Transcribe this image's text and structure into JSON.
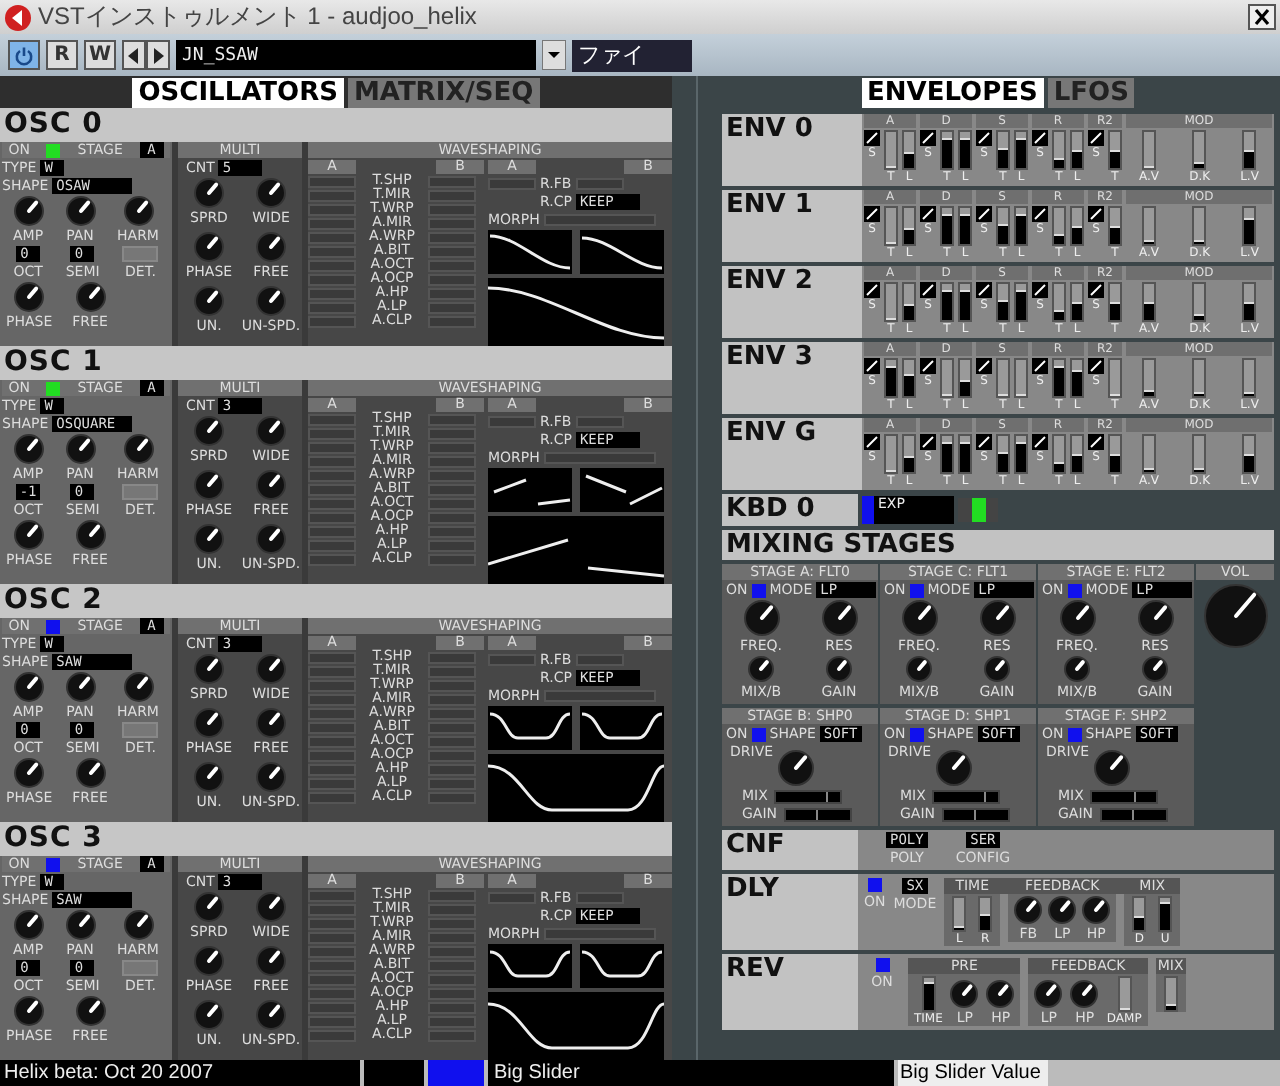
{
  "window": {
    "title": "VSTインストゥルメント 1 - audjoo_helix"
  },
  "toolbar": {
    "power_on": true,
    "read_button": "R",
    "write_button": "W",
    "preset": "JN_SSAW",
    "file_field": "ファイ"
  },
  "left_tabs": [
    {
      "label": "OSCILLATORS",
      "selected": true
    },
    {
      "label": "MATRIX/SEQ",
      "selected": false
    }
  ],
  "oscillators": [
    {
      "title": "OSC 0",
      "on_label": "ON",
      "led": {
        "color": "#22dd22"
      },
      "stage_label": "STAGE",
      "stage": "A",
      "type_label": "TYPE",
      "type": "W",
      "shape_label": "SHAPE",
      "shape": "OSAW",
      "knobs_top": [
        "AMP",
        "PAN",
        "HARM"
      ],
      "oct_label": "OCT",
      "oct": "0",
      "semi_label": "SEMI",
      "semi": "0",
      "det_label": "DET.",
      "knobs_bottom": [
        "PHASE",
        "FREE"
      ],
      "multi": {
        "title": "MULTI",
        "cnt_label": "CNT",
        "cnt": "5",
        "knobs": [
          "SPRD",
          "WIDE",
          "PHASE",
          "FREE",
          "UN.",
          "UN-SPD."
        ]
      },
      "waveshaping": {
        "title": "WAVESHAPING",
        "col_a": "A",
        "col_b": "B",
        "params": [
          "T.SHP",
          "T.MIR",
          "T.WRP",
          "A.MIR",
          "A.WRP",
          "A.BIT",
          "A.OCT",
          "A.OCP",
          "A.HP",
          "A.LP",
          "A.CLP"
        ],
        "morph_a": "A",
        "morph_b": "B",
        "rfb_label": "R.FB",
        "rcp_label": "R.CP",
        "rcp": "KEEP",
        "morph_label": "MORPH"
      }
    },
    {
      "title": "OSC 1",
      "on_label": "ON",
      "led": {
        "color": "#22dd22"
      },
      "stage_label": "STAGE",
      "stage": "A",
      "type_label": "TYPE",
      "type": "W",
      "shape_label": "SHAPE",
      "shape": "OSQUARE",
      "knobs_top": [
        "AMP",
        "PAN",
        "HARM"
      ],
      "oct_label": "OCT",
      "oct": "-1",
      "semi_label": "SEMI",
      "semi": "0",
      "det_label": "DET.",
      "knobs_bottom": [
        "PHASE",
        "FREE"
      ],
      "multi": {
        "title": "MULTI",
        "cnt_label": "CNT",
        "cnt": "3",
        "knobs": [
          "SPRD",
          "WIDE",
          "PHASE",
          "FREE",
          "UN.",
          "UN-SPD."
        ]
      },
      "waveshaping": {
        "title": "WAVESHAPING",
        "col_a": "A",
        "col_b": "B",
        "params": [
          "T.SHP",
          "T.MIR",
          "T.WRP",
          "A.MIR",
          "A.WRP",
          "A.BIT",
          "A.OCT",
          "A.OCP",
          "A.HP",
          "A.LP",
          "A.CLP"
        ],
        "morph_a": "A",
        "morph_b": "B",
        "rfb_label": "R.FB",
        "rcp_label": "R.CP",
        "rcp": "KEEP",
        "morph_label": "MORPH"
      }
    },
    {
      "title": "OSC 2",
      "on_label": "ON",
      "led": {
        "color": "#1010ee"
      },
      "stage_label": "STAGE",
      "stage": "A",
      "type_label": "TYPE",
      "type": "W",
      "shape_label": "SHAPE",
      "shape": "SAW",
      "knobs_top": [
        "AMP",
        "PAN",
        "HARM"
      ],
      "oct_label": "OCT",
      "oct": "0",
      "semi_label": "SEMI",
      "semi": "0",
      "det_label": "DET.",
      "knobs_bottom": [
        "PHASE",
        "FREE"
      ],
      "multi": {
        "title": "MULTI",
        "cnt_label": "CNT",
        "cnt": "3",
        "knobs": [
          "SPRD",
          "WIDE",
          "PHASE",
          "FREE",
          "UN.",
          "UN-SPD."
        ]
      },
      "waveshaping": {
        "title": "WAVESHAPING",
        "col_a": "A",
        "col_b": "B",
        "params": [
          "T.SHP",
          "T.MIR",
          "T.WRP",
          "A.MIR",
          "A.WRP",
          "A.BIT",
          "A.OCT",
          "A.OCP",
          "A.HP",
          "A.LP",
          "A.CLP"
        ],
        "morph_a": "A",
        "morph_b": "B",
        "rfb_label": "R.FB",
        "rcp_label": "R.CP",
        "rcp": "KEEP",
        "morph_label": "MORPH"
      }
    },
    {
      "title": "OSC 3",
      "on_label": "ON",
      "led": {
        "color": "#1010ee"
      },
      "stage_label": "STAGE",
      "stage": "A",
      "type_label": "TYPE",
      "type": "W",
      "shape_label": "SHAPE",
      "shape": "SAW",
      "knobs_top": [
        "AMP",
        "PAN",
        "HARM"
      ],
      "oct_label": "OCT",
      "oct": "0",
      "semi_label": "SEMI",
      "semi": "0",
      "det_label": "DET.",
      "knobs_bottom": [
        "PHASE",
        "FREE"
      ],
      "multi": {
        "title": "MULTI",
        "cnt_label": "CNT",
        "cnt": "3",
        "knobs": [
          "SPRD",
          "WIDE",
          "PHASE",
          "FREE",
          "UN.",
          "UN-SPD."
        ]
      },
      "waveshaping": {
        "title": "WAVESHAPING",
        "col_a": "A",
        "col_b": "B",
        "params": [
          "T.SHP",
          "T.MIR",
          "T.WRP",
          "A.MIR",
          "A.WRP",
          "A.BIT",
          "A.OCT",
          "A.OCP",
          "A.HP",
          "A.LP",
          "A.CLP"
        ],
        "morph_a": "A",
        "morph_b": "B",
        "rfb_label": "R.FB",
        "rcp_label": "R.CP",
        "rcp": "KEEP",
        "morph_label": "MORPH"
      }
    }
  ],
  "right_tabs": [
    {
      "label": "ENVELOPES",
      "selected": true
    },
    {
      "label": "LFOS",
      "selected": false
    }
  ],
  "envelopes": [
    {
      "title": "ENV 0",
      "groups": [
        {
          "label": "A",
          "curve_label": "S",
          "sliders": [
            {
              "label": "T",
              "level": 0
            },
            {
              "label": "L",
              "level": 0.45
            }
          ]
        },
        {
          "label": "D",
          "curve_label": "S",
          "sliders": [
            {
              "label": "T",
              "level": 0.85
            },
            {
              "label": "L",
              "level": 0.85
            }
          ]
        },
        {
          "label": "S",
          "curve_label": "S",
          "sliders": [
            {
              "label": "T",
              "level": 0.55
            },
            {
              "label": "L",
              "level": 0.85
            }
          ]
        },
        {
          "label": "R",
          "curve_label": "S",
          "sliders": [
            {
              "label": "T",
              "level": 0.3
            },
            {
              "label": "L",
              "level": 0.5
            }
          ]
        },
        {
          "label": "R2",
          "curve_label": "S",
          "sliders": [
            {
              "label": "T",
              "level": 0.5
            }
          ]
        }
      ],
      "mod": {
        "label": "MOD",
        "sliders": [
          {
            "label": "A.V",
            "level": 0
          },
          {
            "label": "D.K",
            "level": 0.15
          },
          {
            "label": "L.V",
            "level": 0.5
          }
        ]
      }
    },
    {
      "title": "ENV 1",
      "groups": [
        {
          "label": "A",
          "curve_label": "S",
          "sliders": [
            {
              "label": "T",
              "level": 0
            },
            {
              "label": "L",
              "level": 0.45
            }
          ]
        },
        {
          "label": "D",
          "curve_label": "S",
          "sliders": [
            {
              "label": "T",
              "level": 0.85
            },
            {
              "label": "L",
              "level": 0.85
            }
          ]
        },
        {
          "label": "S",
          "curve_label": "S",
          "sliders": [
            {
              "label": "T",
              "level": 0.55
            },
            {
              "label": "L",
              "level": 0.85
            }
          ]
        },
        {
          "label": "R",
          "curve_label": "S",
          "sliders": [
            {
              "label": "T",
              "level": 0.3
            },
            {
              "label": "L",
              "level": 0.5
            }
          ]
        },
        {
          "label": "R2",
          "curve_label": "S",
          "sliders": [
            {
              "label": "T",
              "level": 0.5
            }
          ]
        }
      ],
      "mod": {
        "label": "MOD",
        "sliders": [
          {
            "label": "A.V",
            "level": 0.1
          },
          {
            "label": "D.K",
            "level": 0.1
          },
          {
            "label": "L.V",
            "level": 0.7
          }
        ]
      }
    },
    {
      "title": "ENV 2",
      "groups": [
        {
          "label": "A",
          "curve_label": "S",
          "sliders": [
            {
              "label": "T",
              "level": 0
            },
            {
              "label": "L",
              "level": 0.45
            }
          ]
        },
        {
          "label": "D",
          "curve_label": "S",
          "sliders": [
            {
              "label": "T",
              "level": 0.85
            },
            {
              "label": "L",
              "level": 0.85
            }
          ]
        },
        {
          "label": "S",
          "curve_label": "S",
          "sliders": [
            {
              "label": "T",
              "level": 0.55
            },
            {
              "label": "L",
              "level": 0.85
            }
          ]
        },
        {
          "label": "R",
          "curve_label": "S",
          "sliders": [
            {
              "label": "T",
              "level": 0.3
            },
            {
              "label": "L",
              "level": 0.5
            }
          ]
        },
        {
          "label": "R2",
          "curve_label": "S",
          "sliders": [
            {
              "label": "T",
              "level": 0.5
            }
          ]
        }
      ],
      "mod": {
        "label": "MOD",
        "sliders": [
          {
            "label": "A.V",
            "level": 0.5
          },
          {
            "label": "D.K",
            "level": 0.15
          },
          {
            "label": "L.V",
            "level": 0.5
          }
        ]
      }
    },
    {
      "title": "ENV 3",
      "groups": [
        {
          "label": "A",
          "curve_label": "S",
          "sliders": [
            {
              "label": "T",
              "level": 0.85
            },
            {
              "label": "L",
              "level": 0.6
            }
          ]
        },
        {
          "label": "D",
          "curve_label": "S",
          "sliders": [
            {
              "label": "T",
              "level": 0
            },
            {
              "label": "L",
              "level": 0.45
            }
          ]
        },
        {
          "label": "S",
          "curve_label": "S",
          "sliders": [
            {
              "label": "T",
              "level": 0
            },
            {
              "label": "L",
              "level": 0
            }
          ]
        },
        {
          "label": "R",
          "curve_label": "S",
          "sliders": [
            {
              "label": "T",
              "level": 0.85
            },
            {
              "label": "L",
              "level": 0.7
            }
          ]
        },
        {
          "label": "R2",
          "curve_label": "S",
          "sliders": [
            {
              "label": "T",
              "level": 0
            }
          ]
        }
      ],
      "mod": {
        "label": "MOD",
        "sliders": [
          {
            "label": "A.V",
            "level": 0.15
          },
          {
            "label": "D.K",
            "level": 0.1
          },
          {
            "label": "L.V",
            "level": 0.1
          }
        ]
      }
    },
    {
      "title": "ENV G",
      "groups": [
        {
          "label": "A",
          "curve_label": "S",
          "sliders": [
            {
              "label": "T",
              "level": 0
            },
            {
              "label": "L",
              "level": 0.45
            }
          ]
        },
        {
          "label": "D",
          "curve_label": "S",
          "sliders": [
            {
              "label": "T",
              "level": 0.85
            },
            {
              "label": "L",
              "level": 0.85
            }
          ]
        },
        {
          "label": "S",
          "curve_label": "S",
          "sliders": [
            {
              "label": "T",
              "level": 0.55
            },
            {
              "label": "L",
              "level": 0.85
            }
          ]
        },
        {
          "label": "R",
          "curve_label": "S",
          "sliders": [
            {
              "label": "T",
              "level": 0.3
            },
            {
              "label": "L",
              "level": 0.5
            }
          ]
        },
        {
          "label": "R2",
          "curve_label": "S",
          "sliders": [
            {
              "label": "T",
              "level": 0.5
            }
          ]
        }
      ],
      "mod": {
        "label": "MOD",
        "sliders": [
          {
            "label": "A.V",
            "level": 0.1
          },
          {
            "label": "D.K",
            "level": 0.1
          },
          {
            "label": "L.V",
            "level": 0.5
          }
        ]
      }
    }
  ],
  "keyboard": {
    "title": "KBD 0",
    "mode": "EXP",
    "level": 0.5
  },
  "mixing": {
    "title": "MIXING STAGES",
    "filters": [
      {
        "title": "STAGE A: FLT0",
        "on_label": "ON",
        "on": true,
        "mode_label": "MODE",
        "mode": "LP",
        "knobs": [
          "FREQ.",
          "RES",
          "MIX/B",
          "GAIN"
        ]
      },
      {
        "title": "STAGE C: FLT1",
        "on_label": "ON",
        "on": true,
        "mode_label": "MODE",
        "mode": "LP",
        "knobs": [
          "FREQ.",
          "RES",
          "MIX/B",
          "GAIN"
        ]
      },
      {
        "title": "STAGE E: FLT2",
        "on_label": "ON",
        "on": true,
        "mode_label": "MODE",
        "mode": "LP",
        "knobs": [
          "FREQ.",
          "RES",
          "MIX/B",
          "GAIN"
        ]
      }
    ],
    "vol_label": "VOL",
    "shapers": [
      {
        "title": "STAGE B: SHP0",
        "on_label": "ON",
        "on": true,
        "shape_label": "SHAPE",
        "shape": "SOFT",
        "drive_label": "DRIVE",
        "mix": {
          "label": "MIX",
          "level": 0.8
        },
        "gain": {
          "label": "GAIN",
          "level": 0.5
        }
      },
      {
        "title": "STAGE D: SHP1",
        "on_label": "ON",
        "on": true,
        "shape_label": "SHAPE",
        "shape": "SOFT",
        "drive_label": "DRIVE",
        "mix": {
          "label": "MIX",
          "level": 0.8
        },
        "gain": {
          "label": "GAIN",
          "level": 0.5
        }
      },
      {
        "title": "STAGE F: SHP2",
        "on_label": "ON",
        "on": true,
        "shape_label": "SHAPE",
        "shape": "SOFT",
        "drive_label": "DRIVE",
        "mix": {
          "label": "MIX",
          "level": 0.7
        },
        "gain": {
          "label": "GAIN",
          "level": 0.5
        }
      }
    ]
  },
  "config": {
    "title": "CNF",
    "poly_value": "POLY",
    "poly_label": "POLY",
    "config_value": "SER",
    "config_label": "CONFIG"
  },
  "delay": {
    "title": "DLY",
    "on_label": "ON",
    "on": true,
    "mode": "SX",
    "mode_label": "MODE",
    "time": {
      "title": "TIME",
      "sliders": [
        {
          "label": "L",
          "level": 0.1
        },
        {
          "label": "R",
          "level": 0.5
        }
      ]
    },
    "feedback": {
      "title": "FEEDBACK",
      "knobs": [
        "FB",
        "LP",
        "HP"
      ]
    },
    "mix": {
      "title": "MIX",
      "sliders": [
        {
          "label": "D",
          "level": 0.45
        },
        {
          "label": "U",
          "level": 0.85
        }
      ]
    }
  },
  "reverb": {
    "title": "REV",
    "on_label": "ON",
    "on": true,
    "pre": {
      "title": "PRE",
      "slider": {
        "label": "TIME",
        "level": 0.9
      },
      "knobs": [
        "LP",
        "HP"
      ]
    },
    "feedback": {
      "title": "FEEDBACK",
      "knobs": [
        "LP",
        "HP"
      ],
      "slider": {
        "label": "DAMP",
        "level": 0.05
      }
    },
    "mix": {
      "title": "MIX",
      "level": 0.2
    }
  },
  "status_bar": {
    "message": "Helix beta: Oct 20 2007",
    "slider_label": "Big Slider",
    "slider_value_label": "Big Slider Value"
  }
}
